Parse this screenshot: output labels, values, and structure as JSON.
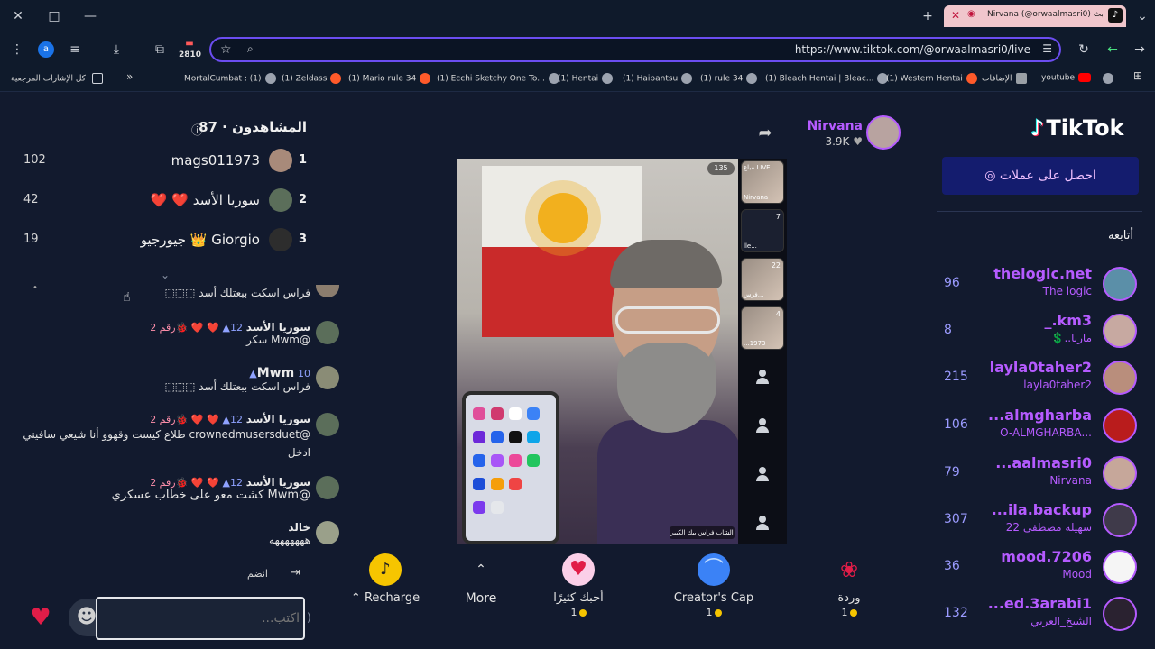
{
  "browser": {
    "tab_title": "Nirvana (@orwaalmasri0) في بث...",
    "url": "https://www.tiktok.com/@orwaalmasri0/live",
    "counter_badge": "2810",
    "profile_initial": "a",
    "new_tab": "+",
    "window_close": "✕",
    "window_restore": "□",
    "window_minimize": "—"
  },
  "bookmarks": {
    "all_bookmarks": "كل الإشارات المرجعية",
    "more": "»",
    "items": [
      {
        "label": "MortalCumbat : (1)",
        "icon": "globe"
      },
      {
        "label": "(1) Zeldass",
        "icon": "reddit"
      },
      {
        "label": "(1) Mario rule 34",
        "icon": "reddit"
      },
      {
        "label": "(1) Ecchi Sketchy One To...",
        "icon": "globe"
      },
      {
        "label": "(1) Hentai",
        "icon": "globe"
      },
      {
        "label": "(1) Haipantsu",
        "icon": "globe"
      },
      {
        "label": "(1) rule 34",
        "icon": "globe"
      },
      {
        "label": "(1) Bleach Hentai | Bleac...",
        "icon": "globe"
      },
      {
        "label": "(1) Western Hentai",
        "icon": "reddit"
      },
      {
        "label": "الإضافات",
        "icon": "puzzle"
      },
      {
        "label": "youtube",
        "icon": "youtube"
      }
    ]
  },
  "viewers": {
    "title": "المشاهدون · 87",
    "top": [
      {
        "rank": "1",
        "name": "mags011973",
        "score": "102"
      },
      {
        "rank": "2",
        "name": "سوريا الأسد ❤️ ❤️",
        "score": "42"
      },
      {
        "rank": "3",
        "name": "Giorgio 👑 جيورجيو",
        "score": "19"
      }
    ]
  },
  "chat": {
    "messages": [
      {
        "name": "",
        "level": "",
        "badge": "",
        "text": "فراس اسكت ببعتلك أسد ⬚⬚⬚"
      },
      {
        "name": "سوريا الأسد",
        "level": "12▲",
        "badge": "❤️ ❤️ 🐞رقم 2",
        "text": "@Mwm سكر"
      },
      {
        "name": "Mwm",
        "level": "10▲",
        "badge": "",
        "text": "فراس اسكت ببعتلك أسد ⬚⬚⬚"
      },
      {
        "name": "سوريا الأسد",
        "level": "12▲",
        "badge": "❤️ ❤️ 🐞رقم 2",
        "text": "@crownedmusersduet طلاع كيست وقهوو أنا شيعي سافيني ادخل"
      },
      {
        "name": "سوريا الأسد",
        "level": "12▲",
        "badge": "❤️ ❤️ 🐞رقم 2",
        "text": "@Mwm كشت معو على خطاب عسكري"
      },
      {
        "name": "خالد",
        "level": "",
        "badge": "",
        "text": "هههههههه"
      }
    ],
    "join_label": "انضم",
    "input_placeholder": "اكتب..."
  },
  "video": {
    "viewer_chip": "135",
    "caption": "الشاب فراس بيك الكبير",
    "strip": [
      {
        "count": "",
        "label": "Nirvana",
        "badge": "مباع LIVE"
      },
      {
        "count": "7",
        "label": "...lle"
      },
      {
        "count": "22",
        "label": "...فرس"
      },
      {
        "count": "4",
        "label": "1973..."
      }
    ]
  },
  "host": {
    "name": "Nirvana",
    "likes": "3.9K"
  },
  "gifts": [
    {
      "name": "Recharge",
      "price": "",
      "icon": "coin"
    },
    {
      "name": "More",
      "price": "",
      "icon": "chevron-up"
    },
    {
      "name": "أحبك كثيرًا",
      "price": "1",
      "icon": "heart-hug"
    },
    {
      "name": "Creator's Cap",
      "price": "1",
      "icon": "cap"
    },
    {
      "name": "وردة",
      "price": "1",
      "icon": "rose"
    }
  ],
  "sidebar": {
    "logo": "TikTok",
    "coins_button": "احصل على عملات",
    "following_label": "أتابعه",
    "following": [
      {
        "name": "thelogic.net",
        "sub": "The logic",
        "count": "96"
      },
      {
        "name": "_.km3",
        "sub": "ماريا..💲",
        "count": "8"
      },
      {
        "name": "layla0taher2",
        "sub": "layla0taher2",
        "count": "215"
      },
      {
        "name": "...almgharba",
        "sub": "...O-ALMGHARBA",
        "count": "106"
      },
      {
        "name": "...aalmasri0",
        "sub": "Nirvana",
        "count": "79"
      },
      {
        "name": "...ila.backup",
        "sub": "سهيلة مصطفى 22",
        "count": "307"
      },
      {
        "name": "mood.7206",
        "sub": "Mood",
        "count": "36"
      },
      {
        "name": "...ed.3arabi1",
        "sub": "الشيخ_العربي",
        "count": "132"
      }
    ]
  },
  "colors": {
    "accent": "#b55bff",
    "background": "#121a2e",
    "coins_button": "#141c6e",
    "heart": "#e11d48",
    "coin": "#f6c500"
  }
}
